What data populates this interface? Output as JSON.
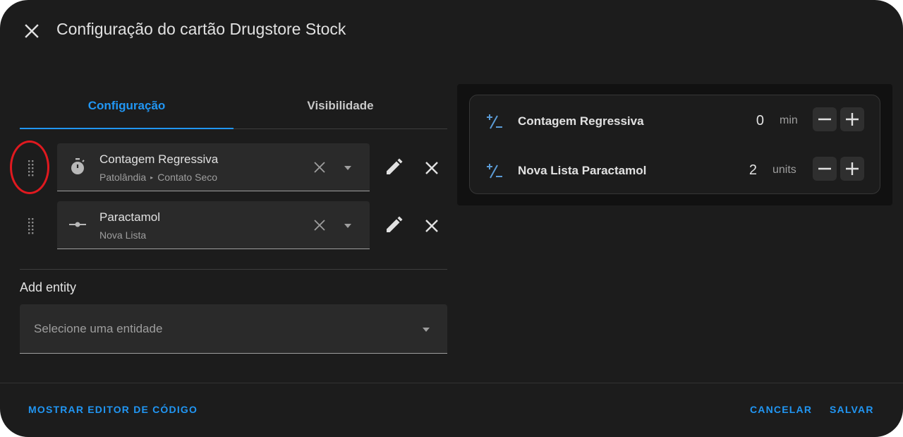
{
  "dialog": {
    "title": "Configuração do cartão Drugstore Stock"
  },
  "tabs": [
    {
      "label": "Configuração",
      "active": true
    },
    {
      "label": "Visibilidade",
      "active": false
    }
  ],
  "entities": [
    {
      "name": "Contagem Regressiva",
      "area": "Patolândia",
      "device": "Contato Seco",
      "icon": "timer-icon"
    },
    {
      "name": "Paractamol",
      "area": "Nova Lista",
      "device": "",
      "icon": "slider-icon"
    }
  ],
  "add_entity": {
    "label": "Add entity",
    "placeholder": "Selecione uma entidade"
  },
  "preview": {
    "rows": [
      {
        "name": "Contagem Regressiva",
        "value": "0",
        "unit": "min",
        "icon": "plus-minus-icon"
      },
      {
        "name": "Nova Lista Paractamol",
        "value": "2",
        "unit": "units",
        "icon": "plus-minus-icon"
      }
    ]
  },
  "footer": {
    "code_editor": "MOSTRAR EDITOR DE CÓDIGO",
    "cancel": "CANCELAR",
    "save": "SALVAR"
  },
  "colors": {
    "accent": "#2196f3",
    "background": "#1c1c1c",
    "highlight_ring": "#e0191f"
  }
}
